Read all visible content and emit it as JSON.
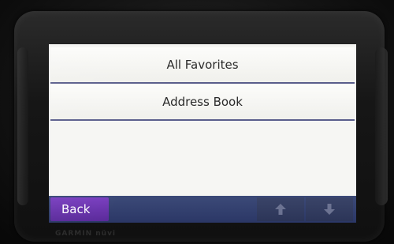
{
  "device": {
    "brand": "GARMIN nüvi"
  },
  "menu": {
    "items": [
      {
        "label": "All Favorites"
      },
      {
        "label": "Address Book"
      }
    ]
  },
  "toolbar": {
    "back_label": "Back",
    "up_icon": "arrow-up-icon",
    "down_icon": "arrow-down-icon"
  },
  "colors": {
    "screen_bg": "#f4f4f1",
    "divider": "#5a5e8c",
    "toolbar": "#2b3766",
    "back_button": "#6a35ae"
  }
}
